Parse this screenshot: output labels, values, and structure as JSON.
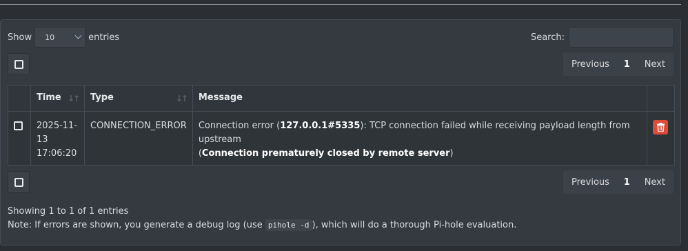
{
  "controls": {
    "show_label": "Show",
    "entries_value": "10",
    "entries_label": "entries",
    "search_label": "Search:",
    "search_value": ""
  },
  "pagination": {
    "previous": "Previous",
    "page": "1",
    "next": "Next"
  },
  "table": {
    "columns": [
      "Time",
      "Type",
      "Message"
    ],
    "rows": [
      {
        "time_line1": "2025-11-",
        "time_line2": "13",
        "time_line3": "17:06:20",
        "type": "CONNECTION_ERROR",
        "msg_prefix": "Connection error (",
        "msg_addr": "127.0.0.1#5335",
        "msg_mid": "): TCP connection failed while receiving payload length from upstream",
        "msg_open": "(",
        "msg_reason": "Connection prematurely closed by remote server",
        "msg_close": ")"
      }
    ]
  },
  "footer": {
    "showing": "Showing 1 to 1 of 1 entries",
    "note_prefix": "Note: If errors are shown, you generate a debug log (use ",
    "note_code": "pihole -d",
    "note_suffix": "), which will do a thorough Pi-hole evaluation."
  },
  "colors": {
    "delete_button": "#dd4b39",
    "panel": "#343a40"
  }
}
